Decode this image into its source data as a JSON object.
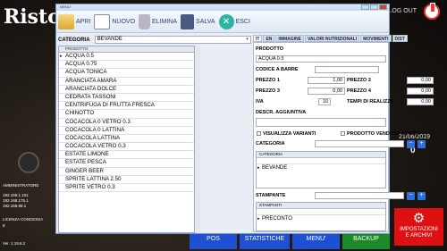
{
  "app": {
    "logo_text": "Risto",
    "logout_label": "LOG OUT",
    "admin_label": "AMMINISTRATORE",
    "ips": [
      "192.168.1.101",
      "192.168.175.1",
      "192.168.98.1"
    ],
    "license_label": "LICENZA CONCESSA",
    "license_value": "8",
    "version": "Ver. 1.19.6.2",
    "date": "21/06/2019",
    "counter": "0"
  },
  "bottom_nav": {
    "pos": "POS",
    "statistiche": "STATISTICHE",
    "menu": "MENU'",
    "backup": "BACKUP",
    "settings": "IMPOSTAZIONI E ARCHIVI"
  },
  "window": {
    "title": "MENU'",
    "toolbar": {
      "apri": "APRI",
      "nuovo": "NUOVO",
      "elimina": "ELIMINA",
      "salva": "SALVA",
      "esci": "ESCI"
    },
    "category_label": "CATEGORIA",
    "category_value": "BEVANDE",
    "list_header": "PRODOTTO",
    "products": [
      "ACQUA 0.5",
      "ACQUA 0.75",
      "ACQUA TONICA",
      "ARANCIATA AMARA",
      "ARANCIATA DOLCE",
      "CEDRATA TASSONI",
      "CENTRIFUGA DI FRUTTA FRESCA",
      "CHINOTTO",
      "COCACOLA 0  VETRO 0.3",
      "COCACOLA 0 LATTINA",
      "COCACOLA LATTINA",
      "COCACOLA VETRO 0.3",
      "ESTATE LIMONE",
      "ESTATE PESCA",
      "GINGER BEER",
      "SPRITE LATTINA 2.50",
      "SPRITE VETRO 0.3"
    ],
    "tabs": [
      "IT",
      "EN",
      "IMMAGINE",
      "VALORI NUTRIZIONALI",
      "MOVIMENTI",
      "DIST"
    ],
    "detail": {
      "prodotto_label": "PRODOTTO",
      "prodotto_value": "ACQUA 0.5",
      "barcode_label": "CODICE A BARRE",
      "prezzo1_label": "PREZZO 1",
      "prezzo1_value": "1,00",
      "prezzo2_label": "PREZZO 2",
      "prezzo2_value": "0,00",
      "prezzo3_label": "PREZZO 3",
      "prezzo3_value": "0,00",
      "prezzo4_label": "PREZZO 4",
      "prezzo4_value": "0,00",
      "iva_label": "IVA",
      "iva_value": "10",
      "tempi_label": "TEMPI DI REALIZZO",
      "tempi_value": "0,00",
      "descr_label": "DESCR. AGGIUNTIVA",
      "varianti_label": "VISUALIZZA VARIANTI",
      "peso_label": "PRODOTTO VENDUTO A PESO",
      "categoria_label": "CATEGORIA",
      "categoria_grid_header": "CATEGORIA",
      "categoria_grid_value": "BEVANDE",
      "stampante_label": "STAMPANTE",
      "stampanti_grid_header": "STAMPANTI",
      "stampanti_grid_value": "PRECONTO"
    }
  }
}
